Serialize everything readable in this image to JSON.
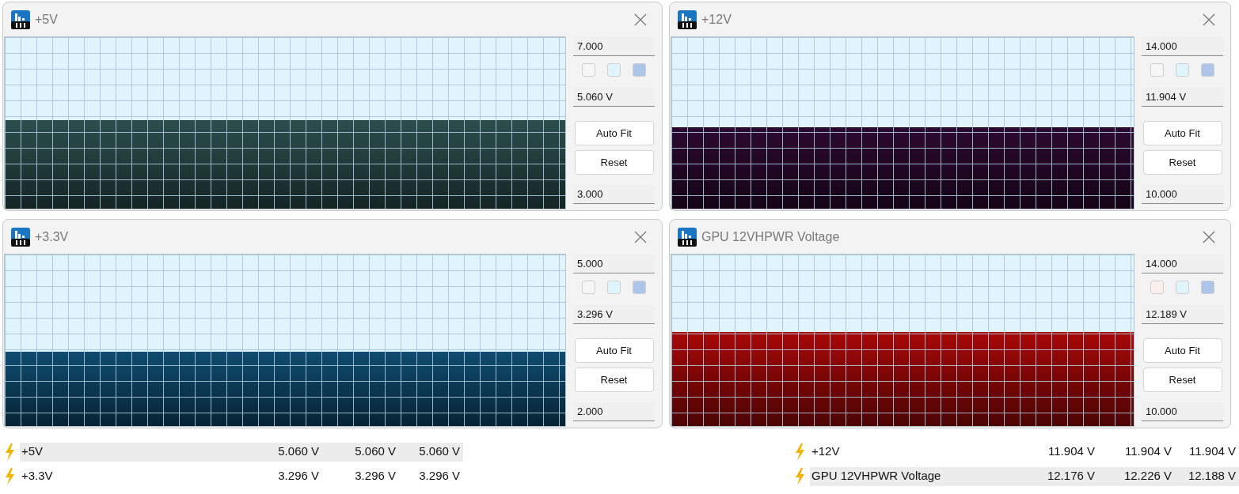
{
  "panels": [
    {
      "title": "+5V",
      "max": "7.000",
      "current": "5.060 V",
      "min": "3.000",
      "buttons": [
        "Auto Fit",
        "Reset"
      ],
      "swatches": [
        {
          "color": "#f6f6f6"
        },
        {
          "color": "#dff4fb"
        },
        {
          "color": "#adc5e8"
        }
      ],
      "graph": {
        "color": "#2b4f4e"
      }
    },
    {
      "title": "+12V",
      "max": "14.000",
      "current": "11.904 V",
      "min": "10.000",
      "buttons": [
        "Auto Fit",
        "Reset"
      ],
      "swatches": [
        {
          "color": "#f6f6f6"
        },
        {
          "color": "#dff4fb"
        },
        {
          "color": "#adc5e8"
        }
      ],
      "graph": {
        "color": "#2c0a30"
      }
    },
    {
      "title": "+3.3V",
      "max": "5.000",
      "current": "3.296 V",
      "min": "2.000",
      "buttons": [
        "Auto Fit",
        "Reset"
      ],
      "swatches": [
        {
          "color": "#f6f6f6"
        },
        {
          "color": "#dff4fb"
        },
        {
          "color": "#adc5e8"
        }
      ],
      "graph": {
        "color": "#0e4c70"
      }
    },
    {
      "title": "GPU 12VHPWR Voltage",
      "max": "14.000",
      "current": "12.189 V",
      "min": "10.000",
      "buttons": [
        "Auto Fit",
        "Reset"
      ],
      "swatches": [
        {
          "color": "#fdeeee"
        },
        {
          "color": "#dff4fb"
        },
        {
          "color": "#adc5e8"
        }
      ],
      "graph": {
        "color": "#a80808"
      }
    }
  ],
  "sensor_lists": [
    {
      "rows": [
        {
          "name": "+5V",
          "values": [
            "5.060 V",
            "5.060 V",
            "5.060 V"
          ],
          "selected": true
        },
        {
          "name": "+3.3V",
          "values": [
            "3.296 V",
            "3.296 V",
            "3.296 V"
          ],
          "selected": false
        }
      ]
    },
    {
      "rows": [
        {
          "name": "+12V",
          "values": [
            "11.904 V",
            "11.904 V",
            "11.904 V"
          ],
          "selected": false
        },
        {
          "name": "GPU 12VHPWR Voltage",
          "values": [
            "12.176 V",
            "12.226 V",
            "12.188 V"
          ],
          "selected": true
        }
      ]
    }
  ]
}
